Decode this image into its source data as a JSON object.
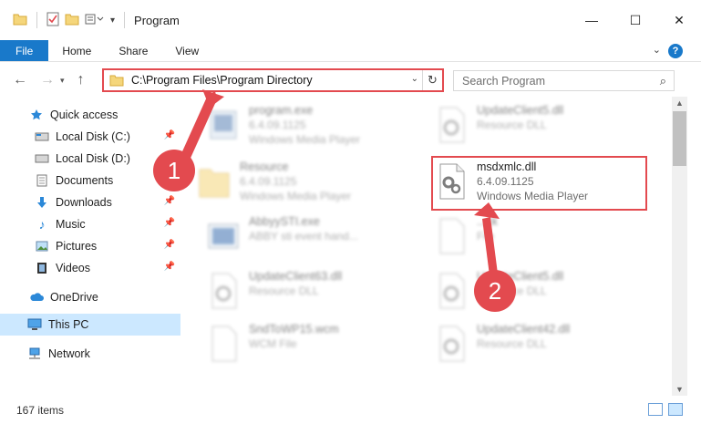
{
  "window": {
    "title": "Program"
  },
  "ribbon": {
    "tabs": [
      "File",
      "Home",
      "Share",
      "View"
    ],
    "help": "?"
  },
  "address": {
    "path": "C:\\Program Files\\Program Directory"
  },
  "search": {
    "placeholder": "Search Program"
  },
  "sidebar": {
    "items": [
      {
        "label": "Quick access"
      },
      {
        "label": "Local Disk (C:)"
      },
      {
        "label": "Local Disk (D:)"
      },
      {
        "label": "Documents"
      },
      {
        "label": "Downloads"
      },
      {
        "label": "Music"
      },
      {
        "label": "Pictures"
      },
      {
        "label": "Videos"
      },
      {
        "label": "OneDrive"
      },
      {
        "label": "This PC"
      },
      {
        "label": "Network"
      }
    ]
  },
  "files": {
    "left": [
      {
        "name": "program.exe",
        "line2": "6.4.09.1125",
        "line3": "Windows Media Player"
      },
      {
        "name": "Resource",
        "line2": "6.4.09.1125",
        "line3": "Windows Media Player"
      },
      {
        "name": "AbbyySTI.exe",
        "line2": "ABBY sti event hand...",
        "line3": ""
      },
      {
        "name": "UpdateClient63.dll",
        "line2": "Resource DLL",
        "line3": ""
      },
      {
        "name": "SndToWP15.wcm",
        "line2": "WCM File",
        "line3": ""
      }
    ],
    "right": [
      {
        "name": "UpdateClient5.dll",
        "line2": "Resource DLL",
        "line3": ""
      },
      {
        "name": "msdxmlc.dll",
        "line2": "6.4.09.1125",
        "line3": "Windows Media Player"
      },
      {
        "name": "...ck",
        "line2": "File",
        "line3": ""
      },
      {
        "name": "UpdateClient5.dll",
        "line2": "Resource DLL",
        "line3": ""
      },
      {
        "name": "UpdateClient42.dll",
        "line2": "Resource DLL",
        "line3": ""
      }
    ]
  },
  "status": {
    "count": "167 items"
  },
  "callouts": {
    "one": "1",
    "two": "2"
  },
  "colors": {
    "accent": "#1979ca",
    "highlight": "#e34a4f",
    "selected": "#cce8ff"
  }
}
